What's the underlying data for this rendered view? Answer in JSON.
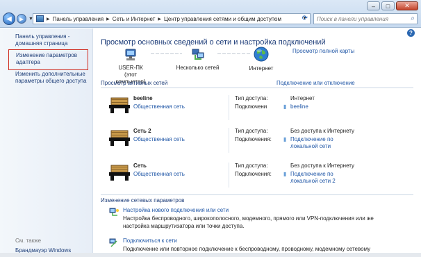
{
  "window": {
    "controls": {
      "minimize": "–",
      "maximize": "□",
      "close": "✕"
    }
  },
  "address_bar": {
    "crumbs": [
      "Панель управления",
      "Сеть и Интернет",
      "Центр управления сетями и общим доступом"
    ]
  },
  "search": {
    "placeholder": "Поиск в панели управления"
  },
  "sidebar": {
    "items": [
      {
        "label": "Панель управления - домашняя страница"
      },
      {
        "label": "Изменение параметров адаптера"
      },
      {
        "label": "Изменить дополнительные параметры общего доступа"
      }
    ],
    "see_also": "См. также",
    "see_also_items": [
      {
        "label": "Брандмауэр Windows"
      }
    ]
  },
  "main": {
    "title": "Просмотр основных сведений о сети и настройка подключений",
    "full_map_link": "Просмотр полной карты",
    "map": {
      "computer_label": "USER-ПК",
      "computer_sub": "(этот компьютер)",
      "networks_label": "Несколько сетей",
      "internet_label": "Интернет"
    },
    "active_title": "Просмотр активных сетей",
    "connect_link": "Подключение или отключение",
    "networks": [
      {
        "name": "beeline",
        "type": "Общественная сеть",
        "access_key": "Тип доступа:",
        "access_val": "Интернет",
        "conn_key": "Подключени",
        "conn_val": "beeline"
      },
      {
        "name": "Сеть  2",
        "type": "Общественная сеть",
        "access_key": "Тип доступа:",
        "access_val": "Без доступа к Интернету",
        "conn_key": "Подключения:",
        "conn_val": "Подключение по локальной сети"
      },
      {
        "name": "Сеть",
        "type": "Общественная сеть",
        "access_key": "Тип доступа:",
        "access_val": "Без доступа к Интернету",
        "conn_key": "Подключения:",
        "conn_val": "Подключение по локальной сети 2"
      }
    ],
    "change_title": "Изменение сетевых параметров",
    "tasks": [
      {
        "title": "Настройка нового подключения или сети",
        "desc": "Настройка беспроводного, широкополосного, модемного, прямого или VPN-подключения или же настройка маршрутизатора или точки доступа."
      },
      {
        "title": "Подключиться к сети",
        "desc": "Подключение или повторное подключение к беспроводному, проводному, модемному сетевому соединению или подключению к VPN"
      }
    ]
  },
  "colors": {
    "link": "#1f56a6",
    "title": "#1a3a77",
    "selection_border": "#cf2a1e"
  }
}
